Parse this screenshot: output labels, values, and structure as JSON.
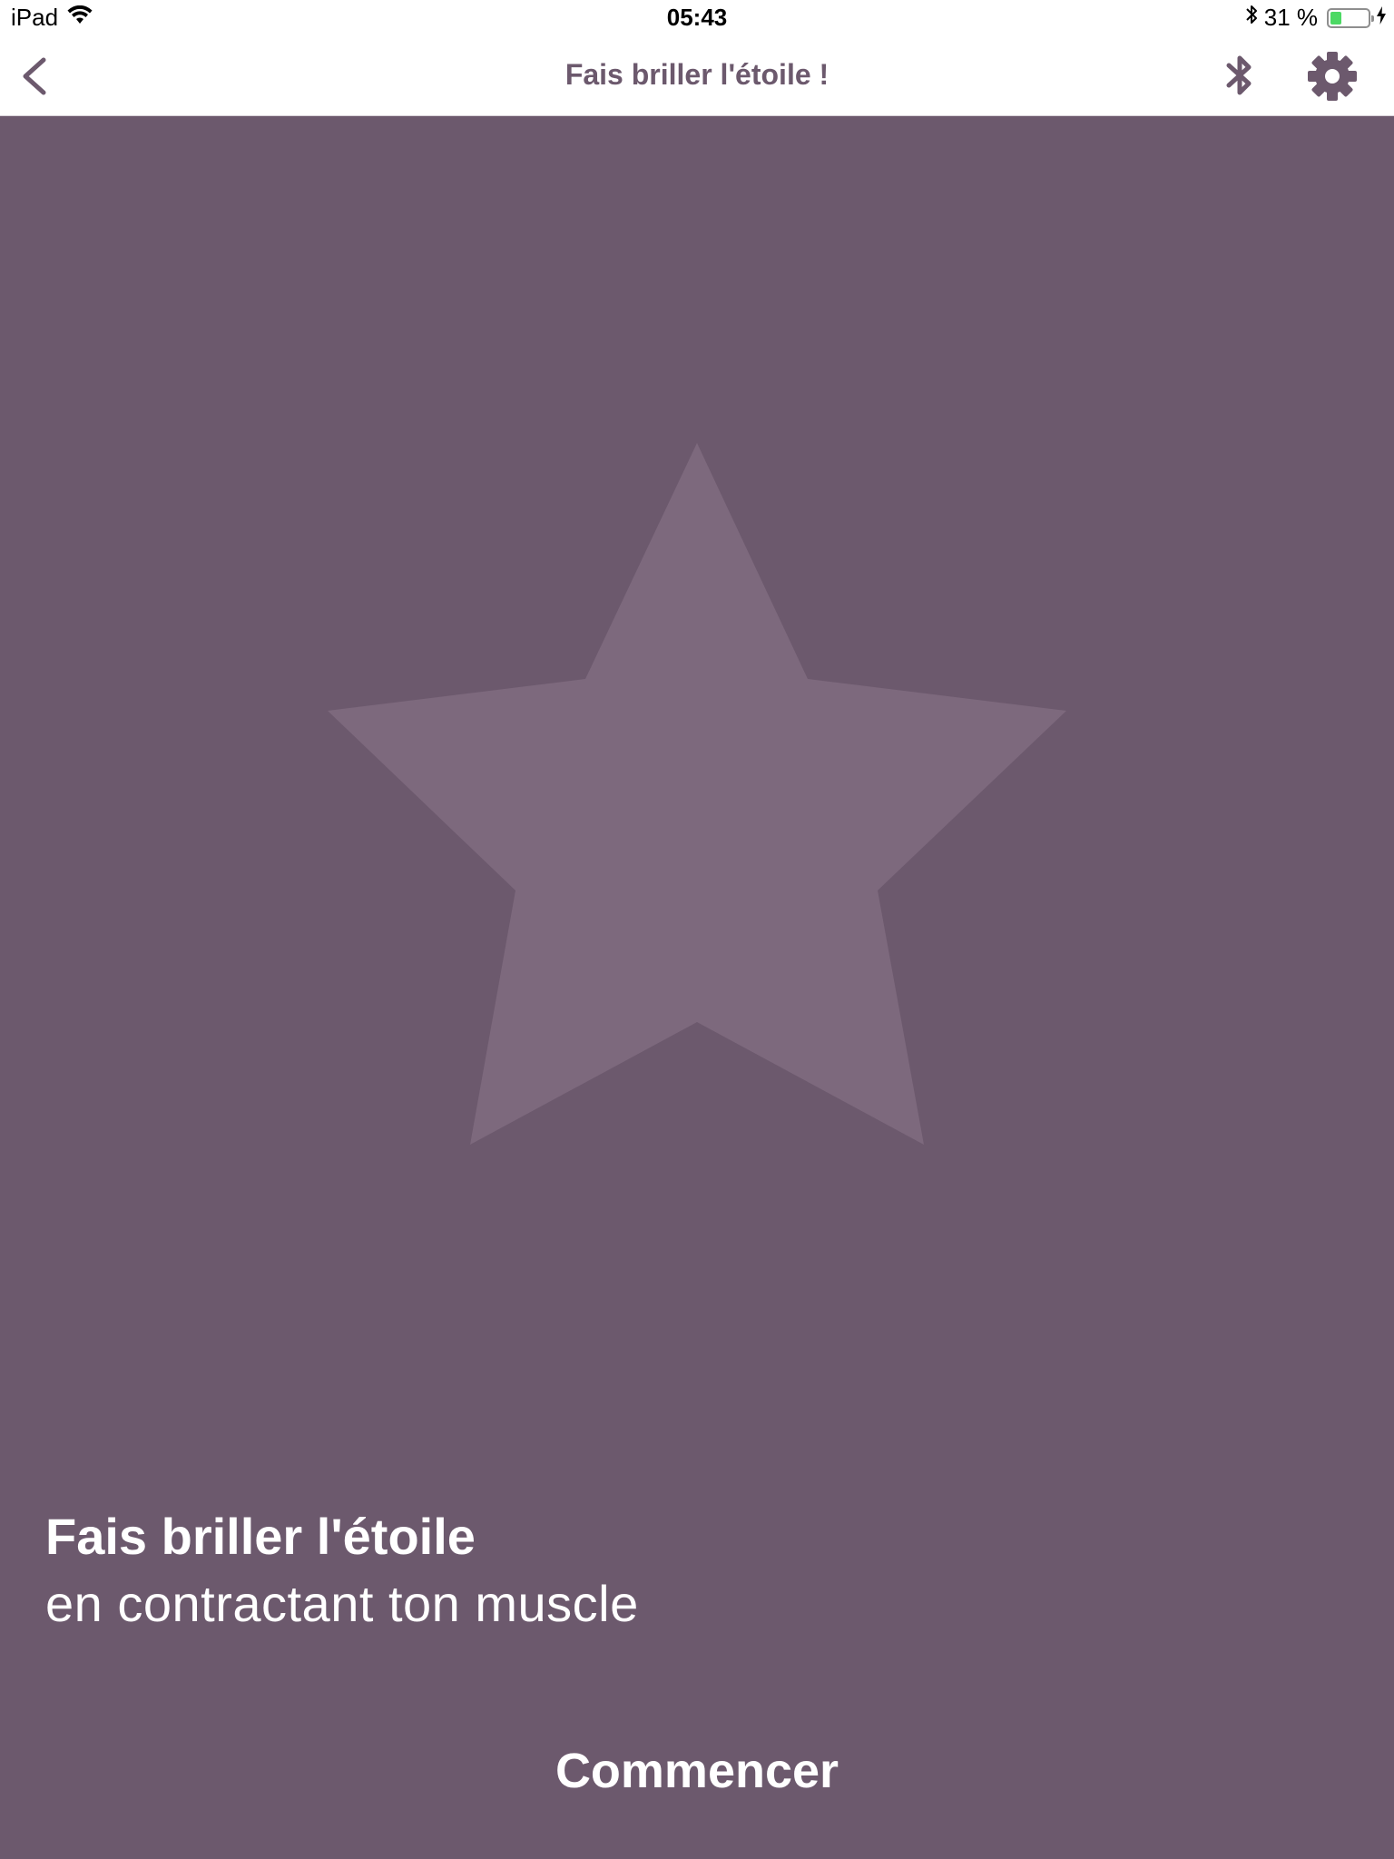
{
  "status_bar": {
    "device": "iPad",
    "time": "05:43",
    "battery_text": "31 %",
    "battery_level": 0.31,
    "icons": [
      "wifi-icon",
      "bluetooth-icon",
      "battery-icon",
      "charging-icon"
    ]
  },
  "nav": {
    "title": "Fais briller l'étoile !",
    "icons": [
      "back-chevron-icon",
      "bluetooth-icon",
      "gear-icon"
    ]
  },
  "main": {
    "star_icon": "star-icon",
    "headline": "Fais briller l'étoile",
    "subline": "en contractant ton muscle",
    "start_label": "Commencer"
  },
  "colors": {
    "background": "#6c596d",
    "star": "#7d697d",
    "accent": "#6c596d",
    "bar_background": "#ffffff",
    "text_on_background": "#ffffff",
    "battery_fill": "#4cd964"
  }
}
